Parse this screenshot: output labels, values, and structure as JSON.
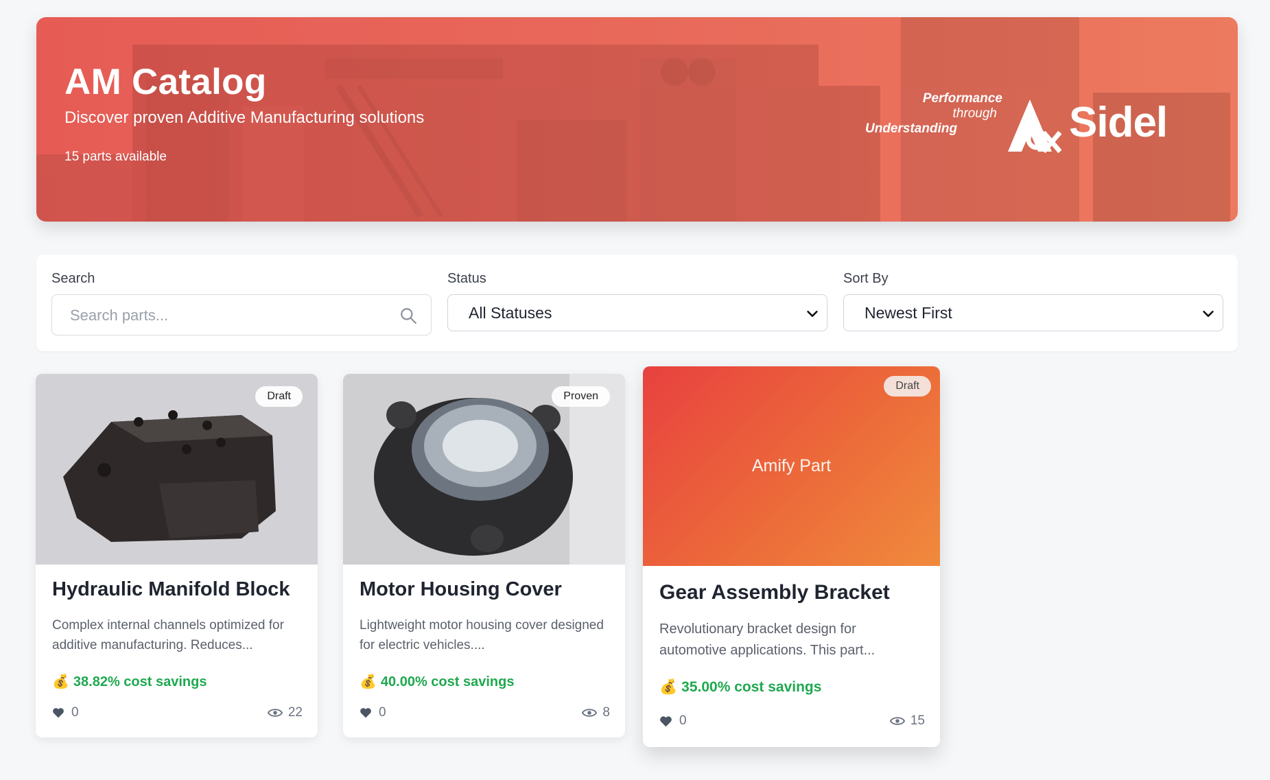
{
  "hero": {
    "title": "AM Catalog",
    "subtitle": "Discover proven Additive Manufacturing solutions",
    "count": "15 parts available",
    "tagline": [
      "Performance",
      "through",
      "Understanding"
    ],
    "brand": "Sidel"
  },
  "filters": {
    "search_label": "Search",
    "search_placeholder": "Search parts...",
    "status_label": "Status",
    "status_value": "All Statuses",
    "sort_label": "Sort By",
    "sort_value": "Newest First"
  },
  "parts": [
    {
      "badge": "Draft",
      "title": "Hydraulic Manifold Block",
      "description": "Complex internal channels optimized for additive manufacturing. Reduces...",
      "savings": "38.82% cost savings",
      "likes": "0",
      "views": "22"
    },
    {
      "badge": "Proven",
      "title": "Motor Housing Cover",
      "description": "Lightweight motor housing cover designed for electric vehicles....",
      "savings": "40.00% cost savings",
      "likes": "0",
      "views": "8"
    },
    {
      "badge": "Draft",
      "placeholder_text": "Amify Part",
      "title": "Gear Assembly Bracket",
      "description": "Revolutionary bracket design for automotive applications. This part...",
      "savings": "35.00% cost savings",
      "likes": "0",
      "views": "15"
    }
  ],
  "colors": {
    "hero_red": "#e65c55",
    "savings_green": "#1fa84f",
    "placeholder_gradient_start": "#e8413f",
    "placeholder_gradient_end": "#f08a3c"
  },
  "icons": {
    "search": "search-icon",
    "chevron": "chevron-down-icon",
    "heart": "heart-icon",
    "eye": "eye-icon",
    "money_bag": "money-bag-icon"
  }
}
